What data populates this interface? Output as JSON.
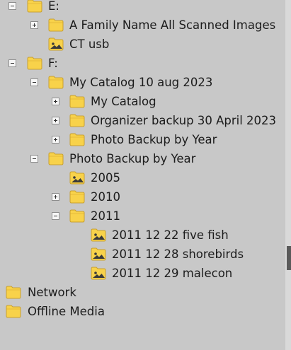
{
  "tree": {
    "e_drive": {
      "label": "E:"
    },
    "family_images": {
      "label": "A Family Name All Scanned Images"
    },
    "ct_usb": {
      "label": "CT usb"
    },
    "f_drive": {
      "label": "F:"
    },
    "my_catalog_aug": {
      "label": "My Catalog 10 aug 2023"
    },
    "my_catalog": {
      "label": "My Catalog"
    },
    "organizer_backup": {
      "label": "Organizer backup 30 April 2023"
    },
    "photo_backup_year_sub": {
      "label": "Photo Backup by Year"
    },
    "photo_backup_year": {
      "label": "Photo Backup by Year"
    },
    "y2005": {
      "label": "2005"
    },
    "y2010": {
      "label": "2010"
    },
    "y2011": {
      "label": "2011"
    },
    "five_fish": {
      "label": "2011 12 22 five fish"
    },
    "shorebirds": {
      "label": "2011 12 28 shorebirds"
    },
    "malecon": {
      "label": "2011 12 29 malecon"
    },
    "network": {
      "label": "Network"
    },
    "offline_media": {
      "label": "Offline Media"
    }
  },
  "colors": {
    "background": "#c8c8c8",
    "folder_fill": "#f8d24a",
    "folder_edge": "#c8a030",
    "image_badge": "#3a3a3a"
  },
  "icons": [
    "folder-icon",
    "image-folder-icon",
    "expand-icon",
    "collapse-icon"
  ]
}
